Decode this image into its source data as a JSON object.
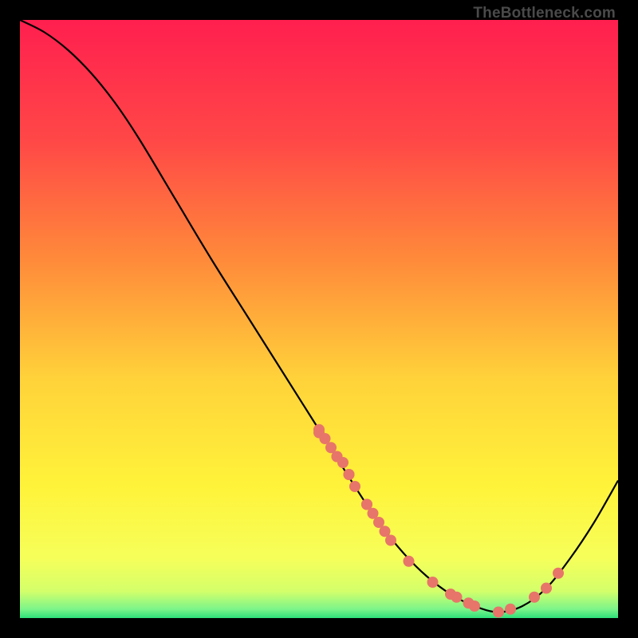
{
  "watermark": "TheBottleneck.com",
  "chart_data": {
    "type": "line",
    "title": "",
    "xlabel": "",
    "ylabel": "",
    "xlim": [
      0,
      100
    ],
    "ylim": [
      0,
      100
    ],
    "curve": {
      "x": [
        0,
        4,
        8,
        12,
        16,
        20,
        26,
        32,
        38,
        44,
        50,
        56,
        60,
        64,
        68,
        72,
        76,
        80,
        84,
        88,
        92,
        96,
        100
      ],
      "y": [
        100,
        98,
        95,
        91,
        86,
        80,
        70,
        60,
        50.5,
        41,
        31.5,
        22,
        16,
        11,
        7,
        4,
        2,
        1,
        2,
        5,
        10,
        16,
        23
      ]
    },
    "markers": {
      "x": [
        50,
        50,
        51,
        52,
        53,
        53,
        54,
        55,
        55,
        56,
        58,
        58,
        59,
        60,
        61,
        62,
        65,
        69,
        72,
        73,
        75,
        76,
        80,
        82,
        86,
        88,
        90
      ],
      "y": [
        31.5,
        31,
        30,
        28.5,
        27,
        27,
        26,
        24,
        24,
        22,
        19,
        19,
        17.5,
        16,
        14.5,
        13,
        9.5,
        6,
        4,
        3.5,
        2.5,
        2,
        1,
        1.5,
        3.5,
        5,
        7.5
      ],
      "color": "#e77569",
      "radius": 7
    },
    "background_gradient": {
      "stops": [
        {
          "offset": 0.0,
          "color": "#ff1f4f"
        },
        {
          "offset": 0.2,
          "color": "#ff4747"
        },
        {
          "offset": 0.4,
          "color": "#ff8a3a"
        },
        {
          "offset": 0.6,
          "color": "#ffd23a"
        },
        {
          "offset": 0.78,
          "color": "#fff33a"
        },
        {
          "offset": 0.9,
          "color": "#f6ff5a"
        },
        {
          "offset": 0.955,
          "color": "#d4ff6a"
        },
        {
          "offset": 0.985,
          "color": "#7cf58a"
        },
        {
          "offset": 1.0,
          "color": "#2de07a"
        }
      ]
    }
  }
}
